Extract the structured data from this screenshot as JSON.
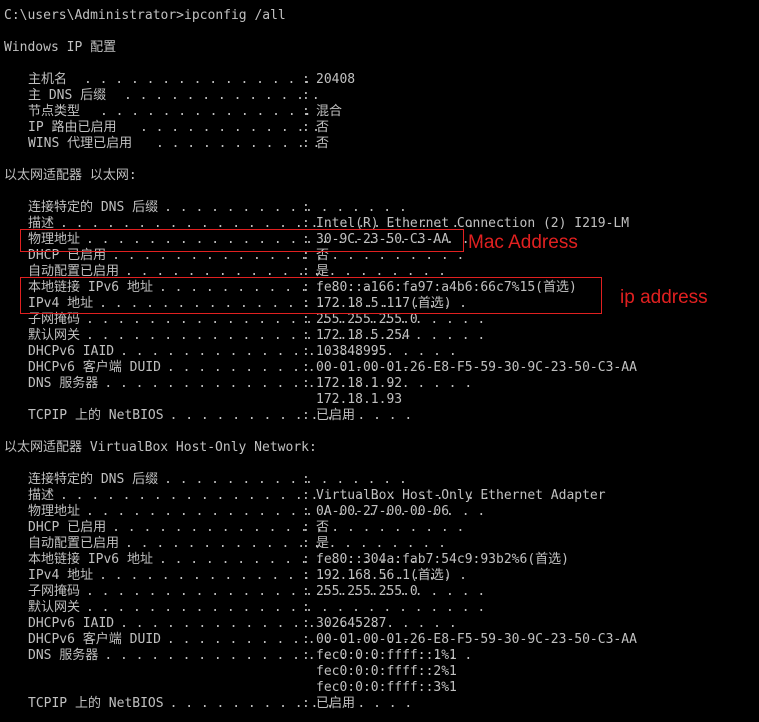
{
  "prompt": "C:\\users\\Administrator>ipconfig /all",
  "header": "Windows IP 配置",
  "global": [
    {
      "label": "主机名",
      "value": "20408"
    },
    {
      "label": "主 DNS 后缀",
      "value": ""
    },
    {
      "label": "节点类型",
      "value": "混合"
    },
    {
      "label": "IP 路由已启用",
      "value": "否"
    },
    {
      "label": "WINS 代理已启用",
      "value": "否"
    }
  ],
  "adapter1": {
    "title": "以太网适配器 以太网:",
    "rows": [
      {
        "label": "连接特定的 DNS 后缀",
        "value": ""
      },
      {
        "label": "描述",
        "value": "Intel(R) Ethernet Connection (2) I219-LM"
      },
      {
        "label": "物理地址",
        "value": "30-9C-23-50-C3-AA"
      },
      {
        "label": "DHCP 已启用",
        "value": "否"
      },
      {
        "label": "自动配置已启用",
        "value": "是"
      },
      {
        "label": "本地链接 IPv6 地址",
        "value": "fe80::a166:fa97:a4b6:66c7%15(首选)"
      },
      {
        "label": "IPv4 地址",
        "value": "172.18.5.117(首选)"
      },
      {
        "label": "子网掩码",
        "value": "255.255.255.0"
      },
      {
        "label": "默认网关",
        "value": "172.18.5.254"
      },
      {
        "label": "DHCPv6 IAID",
        "value": "103848995"
      },
      {
        "label": "DHCPv6 客户端 DUID",
        "value": "00-01-00-01-26-E8-F5-59-30-9C-23-50-C3-AA"
      },
      {
        "label": "DNS 服务器",
        "value": "172.18.1.92"
      },
      {
        "label": "",
        "value": "172.18.1.93"
      },
      {
        "label": "TCPIP 上的 NetBIOS",
        "value": "已启用"
      }
    ]
  },
  "adapter2": {
    "title": "以太网适配器 VirtualBox Host-Only Network:",
    "rows": [
      {
        "label": "连接特定的 DNS 后缀",
        "value": ""
      },
      {
        "label": "描述",
        "value": "VirtualBox Host-Only Ethernet Adapter"
      },
      {
        "label": "物理地址",
        "value": "0A-00-27-00-00-06"
      },
      {
        "label": "DHCP 已启用",
        "value": "否"
      },
      {
        "label": "自动配置已启用",
        "value": "是"
      },
      {
        "label": "本地链接 IPv6 地址",
        "value": "fe80::304a:fab7:54c9:93b2%6(首选)"
      },
      {
        "label": "IPv4 地址",
        "value": "192.168.56.1(首选)"
      },
      {
        "label": "子网掩码",
        "value": "255.255.255.0"
      },
      {
        "label": "默认网关",
        "value": ""
      },
      {
        "label": "DHCPv6 IAID",
        "value": "302645287"
      },
      {
        "label": "DHCPv6 客户端 DUID",
        "value": "00-01-00-01-26-E8-F5-59-30-9C-23-50-C3-AA"
      },
      {
        "label": "DNS 服务器",
        "value": "fec0:0:0:ffff::1%1"
      },
      {
        "label": "",
        "value": "fec0:0:0:ffff::2%1"
      },
      {
        "label": "",
        "value": "fec0:0:0:ffff::3%1"
      },
      {
        "label": "TCPIP 上的 NetBIOS",
        "value": "已启用"
      }
    ]
  },
  "annotations": {
    "mac_label": "Mac Address",
    "ip_label": "ip address",
    "color": "#e02020"
  },
  "theme": {
    "background": "#000000",
    "foreground": "#c0c0c0"
  }
}
